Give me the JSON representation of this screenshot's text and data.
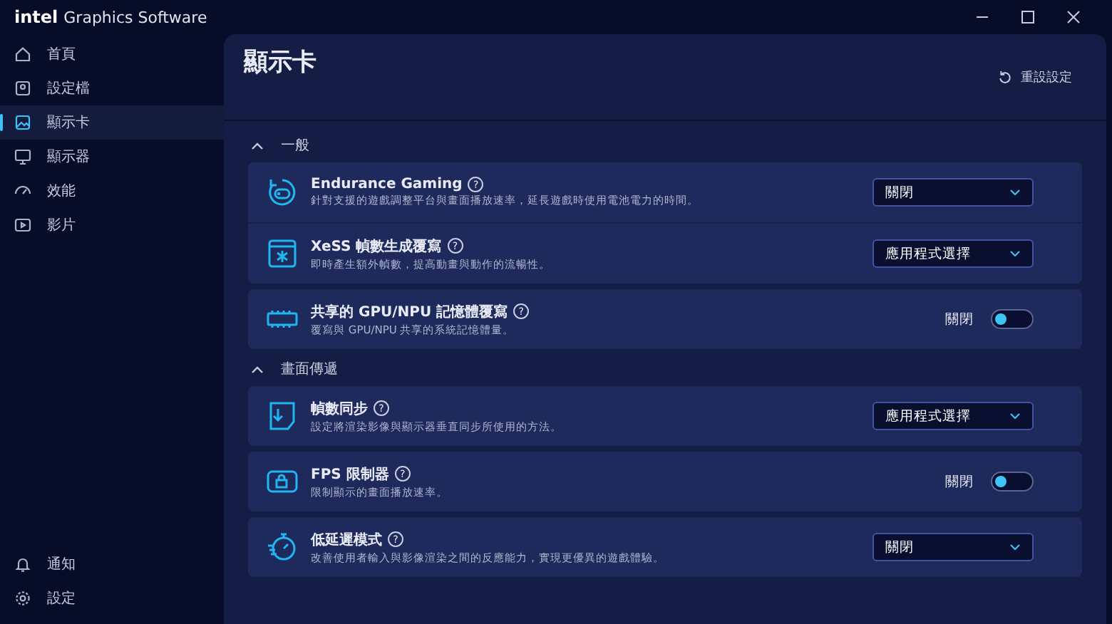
{
  "window": {
    "brand": "intel",
    "title": "Graphics Software"
  },
  "sidebar": {
    "items": [
      {
        "label": "首頁",
        "selected": false
      },
      {
        "label": "設定檔",
        "selected": false
      },
      {
        "label": "顯示卡",
        "selected": true
      },
      {
        "label": "顯示器",
        "selected": false
      },
      {
        "label": "效能",
        "selected": false
      },
      {
        "label": "影片",
        "selected": false
      }
    ],
    "bottom_items": [
      {
        "label": "通知"
      },
      {
        "label": "設定"
      }
    ]
  },
  "page": {
    "title": "顯示卡",
    "reset_button": "重設設定"
  },
  "sections": [
    {
      "title": "一般",
      "expanded": true,
      "groups": [
        [
          {
            "title": "Endurance Gaming",
            "help": "?",
            "description": "針對支援的遊戲調整平台與畫面播放速率，延長遊戲時使用電池電力的時間。",
            "kind": "dropdown",
            "value": "關閉"
          },
          {
            "title": "XeSS 幀數生成覆寫",
            "help": "?",
            "description": "即時產生額外幀數，提高動畫與動作的流暢性。",
            "kind": "dropdown",
            "value": "應用程式選擇"
          }
        ],
        [
          {
            "title": "共享的 GPU/NPU 記憶體覆寫",
            "help": "?",
            "description": "覆寫與 GPU/NPU 共享的系統記憶體量。",
            "kind": "toggle",
            "value": "關閉",
            "on": false
          }
        ]
      ]
    },
    {
      "title": "畫面傳遞",
      "expanded": true,
      "groups": [
        [
          {
            "title": "幀數同步",
            "help": "?",
            "description": "設定將渲染影像與顯示器垂直同步所使用的方法。",
            "kind": "dropdown",
            "value": "應用程式選擇"
          }
        ],
        [
          {
            "title": "FPS 限制器",
            "help": "?",
            "description": "限制顯示的畫面播放速率。",
            "kind": "toggle",
            "value": "關閉",
            "on": false
          }
        ],
        [
          {
            "title": "低延遲模式",
            "help": "?",
            "description": "改善使用者輸入與影像渲染之間的反應能力，實現更優異的遊戲體驗。",
            "kind": "dropdown",
            "value": "關閉"
          }
        ]
      ]
    }
  ]
}
